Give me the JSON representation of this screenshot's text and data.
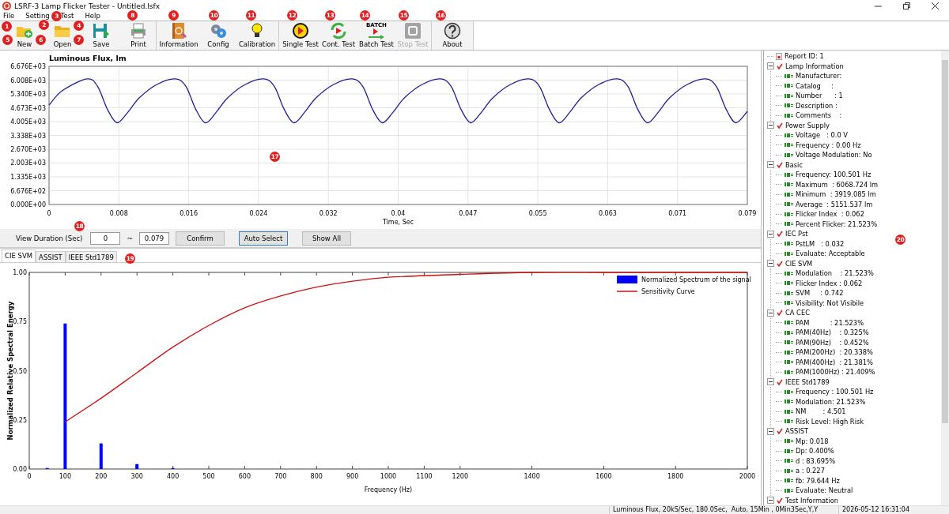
{
  "window": {
    "title": "LSRF-3 Lamp Flicker Tester - Untitled.lsfx"
  },
  "menu": [
    {
      "label": "File"
    },
    {
      "label": "Setting"
    },
    {
      "label": "Test"
    },
    {
      "label": "Help"
    }
  ],
  "toolbar": [
    [
      {
        "label": "New",
        "kind": "new",
        "disabled": false
      },
      {
        "label": "Open",
        "kind": "open",
        "disabled": false
      },
      {
        "label": "Save",
        "kind": "save",
        "disabled": false
      },
      {
        "label": "Print",
        "kind": "print",
        "disabled": false
      }
    ],
    [
      {
        "label": "Information",
        "kind": "info",
        "disabled": false
      },
      {
        "label": "Config",
        "kind": "config",
        "disabled": false
      },
      {
        "label": "Calibration",
        "kind": "calibration",
        "disabled": false
      }
    ],
    [
      {
        "label": "Single Test",
        "kind": "single",
        "disabled": false
      },
      {
        "label": "Cont. Test",
        "kind": "cont",
        "disabled": false
      },
      {
        "label": "Batch Test",
        "kind": "batch",
        "icon_text": "BATCH",
        "disabled": false
      },
      {
        "label": "Stop Test",
        "kind": "stop",
        "disabled": true
      }
    ],
    [
      {
        "label": "About",
        "kind": "about",
        "disabled": false
      }
    ]
  ],
  "flux_chart": {
    "chart_data": {
      "type": "line",
      "title": "Luminous Flux, lm",
      "xlabel": "Time, Sec",
      "xlim": [
        0,
        0.079
      ],
      "ylim": [
        0,
        6676
      ],
      "x": [
        0,
        0.0015,
        0.0043,
        0.0055,
        0.0066,
        0.0077,
        0.0089,
        0.0102,
        0.0122,
        0.0143,
        0.0155,
        0.0166,
        0.0177,
        0.0189,
        0.0202,
        0.0222,
        0.0243,
        0.0255,
        0.0266,
        0.0277,
        0.0289,
        0.0302,
        0.0322,
        0.0343,
        0.0355,
        0.0366,
        0.0377,
        0.0389,
        0.0402,
        0.0422,
        0.0443,
        0.0455,
        0.0466,
        0.0477,
        0.0489,
        0.0502,
        0.0522,
        0.0543,
        0.0555,
        0.0566,
        0.0577,
        0.0589,
        0.0602,
        0.0622,
        0.0643,
        0.0655,
        0.0666,
        0.0677,
        0.0689,
        0.0702,
        0.0722,
        0.0743,
        0.0755,
        0.0766,
        0.0777,
        0.079
      ],
      "grid": true,
      "series": [
        {
          "color": "#1f1f9a",
          "values": [
            4800,
            5500,
            6069,
            5700,
            4600,
            3950,
            4450,
            5150,
            5800,
            6069,
            5700,
            4600,
            3950,
            4450,
            5150,
            5800,
            6069,
            5700,
            4600,
            3950,
            4450,
            5150,
            5800,
            6069,
            5700,
            4600,
            3950,
            4450,
            5150,
            5800,
            6069,
            5700,
            4600,
            3950,
            4450,
            5150,
            5800,
            6069,
            5700,
            4600,
            3950,
            4450,
            5150,
            5800,
            6069,
            5700,
            4600,
            3950,
            4450,
            5150,
            5800,
            6069,
            5700,
            4600,
            3950,
            4500
          ]
        }
      ],
      "xticks": [
        {
          "value": 0,
          "label": "0"
        },
        {
          "value": 0.0079,
          "label": "0.008"
        },
        {
          "value": 0.0158,
          "label": "0.016"
        },
        {
          "value": 0.0237,
          "label": "0.024"
        },
        {
          "value": 0.0316,
          "label": "0.032"
        },
        {
          "value": 0.0395,
          "label": "0.04"
        },
        {
          "value": 0.0474,
          "label": "0.047"
        },
        {
          "value": 0.0553,
          "label": "0.055"
        },
        {
          "value": 0.0632,
          "label": "0.063"
        },
        {
          "value": 0.0711,
          "label": "0.071"
        },
        {
          "value": 0.079,
          "label": "0.079"
        }
      ],
      "yticks": [
        {
          "value": 0,
          "label": "0.000E+00"
        },
        {
          "value": 667.6,
          "label": "6.676E+02"
        },
        {
          "value": 1335,
          "label": "1.335E+03"
        },
        {
          "value": 2003,
          "label": "2.003E+03"
        },
        {
          "value": 2670,
          "label": "2.670E+03"
        },
        {
          "value": 3338,
          "label": "3.338E+03"
        },
        {
          "value": 4005,
          "label": "4.005E+03"
        },
        {
          "value": 4673,
          "label": "4.673E+03"
        },
        {
          "value": 5340,
          "label": "5.340E+03"
        },
        {
          "value": 6008,
          "label": "6.008E+03"
        },
        {
          "value": 6676,
          "label": "6.676E+03"
        }
      ]
    }
  },
  "view_duration": {
    "label": "View Duration (Sec)",
    "from": "0",
    "separator": "~",
    "to": "0.079",
    "buttons": [
      {
        "label": "Confirm",
        "selected": false
      },
      {
        "label": "Auto Select",
        "selected": true
      },
      {
        "label": "Show All",
        "selected": false
      }
    ]
  },
  "tabs": [
    {
      "label": "CIE SVM",
      "selected": true
    },
    {
      "label": "ASSIST",
      "selected": false
    },
    {
      "label": "IEEE Std1789",
      "selected": false
    }
  ],
  "spectrum_chart": {
    "chart_data": {
      "type": "bar",
      "xlabel": "Frequency (Hz)",
      "ylabel": "Normalized Relative Spectral Energy",
      "xlim": [
        0,
        2000
      ],
      "ylim": [
        0,
        1
      ],
      "legend": true,
      "x": [
        50,
        100,
        200,
        300,
        400,
        500,
        600,
        700,
        800,
        900,
        1000,
        1200,
        1400,
        1600,
        1800,
        2000
      ],
      "series": [
        {
          "name": "Normalized Spectrum of the signal",
          "color": "#0000ff",
          "values": [
            0.005,
            0.74,
            0.13,
            0.025,
            0.005,
            null,
            null,
            null,
            null,
            null,
            null,
            null,
            null,
            null,
            null,
            null
          ]
        },
        {
          "name": "Sensitivity Curve",
          "type": "line",
          "color": "#cc1111",
          "values": [
            null,
            0.24,
            0.36,
            0.49,
            0.62,
            0.73,
            0.82,
            0.88,
            0.925,
            0.955,
            0.975,
            0.99,
            1.0,
            1.0,
            1.0,
            1.0
          ]
        }
      ],
      "xticks": [
        {
          "value": 0,
          "label": "0"
        },
        {
          "value": 100,
          "label": "100"
        },
        {
          "value": 200,
          "label": "200"
        },
        {
          "value": 300,
          "label": "300"
        },
        {
          "value": 400,
          "label": "400"
        },
        {
          "value": 500,
          "label": "500"
        },
        {
          "value": 600,
          "label": "600"
        },
        {
          "value": 700,
          "label": "700"
        },
        {
          "value": 800,
          "label": "800"
        },
        {
          "value": 900,
          "label": "900"
        },
        {
          "value": 1000,
          "label": "1000"
        },
        {
          "value": 1100,
          "label": "1100"
        },
        {
          "value": 1200,
          "label": "1200"
        },
        {
          "value": 1400,
          "label": "1400"
        },
        {
          "value": 1600,
          "label": "1600"
        },
        {
          "value": 1800,
          "label": "1800"
        },
        {
          "value": 2000,
          "label": "2000"
        }
      ],
      "yticks": [
        {
          "value": 0,
          "label": "0.00"
        },
        {
          "value": 0.25,
          "label": "0.25"
        },
        {
          "value": 0.5,
          "label": "0.50"
        },
        {
          "value": 0.75,
          "label": "0.75"
        },
        {
          "value": 1,
          "label": "1.00"
        }
      ]
    }
  },
  "report_tree": [
    {
      "label": "Report ID: 1",
      "kind": "report"
    },
    {
      "label": "Lamp Information",
      "kind": "group",
      "checked": true,
      "expanded": true,
      "children": [
        {
          "label": "Manufacturer:"
        },
        {
          "label": "Catalog     :"
        },
        {
          "label": "Number      : 1"
        },
        {
          "label": "Description :"
        },
        {
          "label": "Comments    :"
        }
      ]
    },
    {
      "label": "Power Supply",
      "kind": "group",
      "checked": true,
      "expanded": true,
      "children": [
        {
          "label": "Voltage   : 0.0 V"
        },
        {
          "label": "Frequency : 0.00 Hz"
        },
        {
          "label": "Voltage Modulation: No"
        }
      ]
    },
    {
      "label": "Basic",
      "kind": "group",
      "checked": true,
      "expanded": true,
      "children": [
        {
          "label": "Frequency: 100.501 Hz"
        },
        {
          "label": "Maximum  : 6068.724 lm"
        },
        {
          "label": "Minimum  : 3919.085 lm"
        },
        {
          "label": "Average  : 5151.537 lm"
        },
        {
          "label": "Flicker Index  : 0.062"
        },
        {
          "label": "Percent Flicker: 21.523%"
        }
      ]
    },
    {
      "label": "IEC Pst",
      "kind": "group",
      "checked": true,
      "expanded": true,
      "children": [
        {
          "label": "PstLM   : 0.032"
        },
        {
          "label": "Evaluate: Acceptable"
        }
      ]
    },
    {
      "label": "CIE SVM",
      "kind": "group",
      "checked": true,
      "expanded": true,
      "children": [
        {
          "label": "Modulation    : 21.523%"
        },
        {
          "label": "Flicker Index : 0.062"
        },
        {
          "label": "SVM     : 0.742"
        },
        {
          "label": "Visibility: Not Visibile"
        }
      ]
    },
    {
      "label": "CA CEC",
      "kind": "group",
      "checked": true,
      "expanded": true,
      "children": [
        {
          "label": "PAM          : 21.523%"
        },
        {
          "label": "PAM(40Hz)    : 0.325%"
        },
        {
          "label": "PAM(90Hz)    : 0.452%"
        },
        {
          "label": "PAM(200Hz)  : 20.338%"
        },
        {
          "label": "PAM(400Hz)  : 21.381%"
        },
        {
          "label": "PAM(1000Hz) : 21.409%"
        }
      ]
    },
    {
      "label": "IEEE Std1789",
      "kind": "group",
      "checked": true,
      "expanded": true,
      "children": [
        {
          "label": "Frequency : 100.501 Hz"
        },
        {
          "label": "Modulation: 21.523%"
        },
        {
          "label": "NM        : 4.501"
        },
        {
          "label": "Risk Level: High Risk"
        }
      ]
    },
    {
      "label": "ASSIST",
      "kind": "group",
      "checked": true,
      "expanded": true,
      "children": [
        {
          "label": "Mp: 0.018"
        },
        {
          "label": "Dp: 0.400%"
        },
        {
          "label": "d : 83.695%"
        },
        {
          "label": "a : 0.227"
        },
        {
          "label": "fb: 79.644 Hz"
        },
        {
          "label": "Evaluate: Neutral"
        }
      ]
    },
    {
      "label": "Test Information",
      "kind": "group",
      "checked": true,
      "expanded": true
    }
  ],
  "status_bar": [
    "Luminous Flux, 20kS/Sec, 180.0Sec,  Auto, 15Min , 0Min3Sec,Y,Y",
    "2026-05-12 16:31:04"
  ],
  "callouts": [
    "1",
    "2",
    "3",
    "4",
    "5",
    "6",
    "7",
    "8",
    "9",
    "10",
    "11",
    "12",
    "13",
    "14",
    "15",
    "16",
    "17",
    "18",
    "19",
    "20"
  ]
}
